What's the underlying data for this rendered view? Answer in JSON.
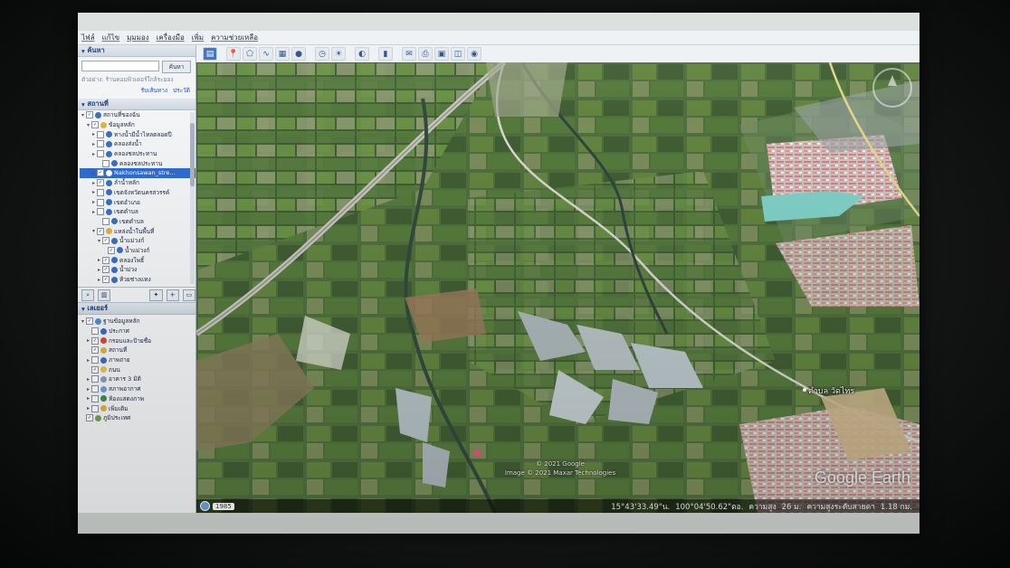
{
  "menu": [
    "ไฟล์",
    "แก้ไข",
    "มุมมอง",
    "เครื่องมือ",
    "เพิ่ม",
    "ความช่วยเหลือ"
  ],
  "search": {
    "title": "ค้นหา",
    "placeholder": "",
    "button": "ค้นหา",
    "hint": "ตัวอย่าง: ร้านคอมพิวเตอร์ใกล้ระยอง",
    "link_directions": "รับเส้นทาง",
    "link_history": "ประวัติ"
  },
  "places": {
    "title": "สถานที่",
    "items": [
      {
        "label": "สถานที่ของฉัน",
        "indent": 0,
        "exp": "▾",
        "checked": true,
        "icon": "folder-icon",
        "color": "#3a6fc2"
      },
      {
        "label": "ข้อมูลหลัก",
        "indent": 1,
        "exp": "▾",
        "checked": true,
        "icon": "folder-icon",
        "color": "#e2b23c"
      },
      {
        "label": "ทางน้ำมีน้ำไหลตลอดปี",
        "indent": 2,
        "exp": "▸",
        "checked": false,
        "icon": "path-icon",
        "color": "#3a6fc2"
      },
      {
        "label": "คลองส่งน้ำ",
        "indent": 2,
        "exp": "▸",
        "checked": false,
        "icon": "path-icon",
        "color": "#3a6fc2"
      },
      {
        "label": "คลองชลประทาน",
        "indent": 2,
        "exp": "▸",
        "checked": false,
        "icon": "path-icon",
        "color": "#3a6fc2"
      },
      {
        "label": "คลองชลประทาน",
        "indent": 3,
        "exp": "",
        "checked": false,
        "icon": "path-icon",
        "color": "#3a6fc2"
      },
      {
        "label": "Nakhonsawan_stre...",
        "indent": 2,
        "exp": "▸",
        "checked": true,
        "icon": "path-icon",
        "color": "#ffffff",
        "selected": true
      },
      {
        "label": "ลำน้ำหลัก",
        "indent": 2,
        "exp": "▸",
        "checked": true,
        "icon": "path-icon",
        "color": "#3a6fc2"
      },
      {
        "label": "เขตจังหวัดนครสวรรค์",
        "indent": 2,
        "exp": "▸",
        "checked": false,
        "icon": "path-icon",
        "color": "#3a6fc2"
      },
      {
        "label": "เขตอำเภอ",
        "indent": 2,
        "exp": "▸",
        "checked": false,
        "icon": "path-icon",
        "color": "#3a6fc2"
      },
      {
        "label": "เขตตำบล",
        "indent": 2,
        "exp": "▸",
        "checked": false,
        "icon": "path-icon",
        "color": "#3a6fc2"
      },
      {
        "label": "เขตตำบล",
        "indent": 3,
        "exp": "",
        "checked": false,
        "icon": "path-icon",
        "color": "#3a6fc2"
      },
      {
        "label": "แหล่งน้ำในพื้นที่",
        "indent": 2,
        "exp": "▾",
        "checked": true,
        "icon": "folder-icon",
        "color": "#e2b23c"
      },
      {
        "label": "น้ำแม่วงก์",
        "indent": 3,
        "exp": "▾",
        "checked": true,
        "icon": "path-icon",
        "color": "#3a6fc2"
      },
      {
        "label": "น้ำแม่วงก์",
        "indent": 4,
        "exp": "",
        "checked": true,
        "icon": "path-icon",
        "color": "#3a6fc2"
      },
      {
        "label": "คลองโพธิ์",
        "indent": 3,
        "exp": "▸",
        "checked": true,
        "icon": "path-icon",
        "color": "#3a6fc2"
      },
      {
        "label": "น้ำม่วง",
        "indent": 3,
        "exp": "▸",
        "checked": true,
        "icon": "path-icon",
        "color": "#3a6fc2"
      },
      {
        "label": "ห้วยช่างแทง",
        "indent": 3,
        "exp": "▸",
        "checked": true,
        "icon": "path-icon",
        "color": "#3a6fc2"
      }
    ]
  },
  "layers": {
    "title": "เลเยอร์",
    "items": [
      {
        "label": "ฐานข้อมูลหลัก",
        "indent": 0,
        "exp": "▾",
        "checked": true,
        "icon": "globe-icon",
        "color": "#4a8fd6"
      },
      {
        "label": "ประกาศ",
        "indent": 1,
        "exp": "",
        "checked": false,
        "icon": "info-icon",
        "color": "#3a6fc2"
      },
      {
        "label": "กรอบและป้ายชื่อ",
        "indent": 1,
        "exp": "▸",
        "checked": true,
        "icon": "label-icon",
        "color": "#d9473b"
      },
      {
        "label": "สถานที่",
        "indent": 1,
        "exp": "",
        "checked": true,
        "icon": "place-icon",
        "color": "#e2b23c"
      },
      {
        "label": "ภาพถ่าย",
        "indent": 1,
        "exp": "▸",
        "checked": false,
        "icon": "photo-icon",
        "color": "#3a6fc2"
      },
      {
        "label": "ถนน",
        "indent": 1,
        "exp": "",
        "checked": true,
        "icon": "road-icon",
        "color": "#e8c547"
      },
      {
        "label": "อาคาร 3 มิติ",
        "indent": 1,
        "exp": "▸",
        "checked": false,
        "icon": "building-icon",
        "color": "#8aa0b8"
      },
      {
        "label": "สภาพอากาศ",
        "indent": 1,
        "exp": "▸",
        "checked": false,
        "icon": "weather-icon",
        "color": "#6fa0df"
      },
      {
        "label": "ห้องแสดงภาพ",
        "indent": 1,
        "exp": "▸",
        "checked": false,
        "icon": "gallery-icon",
        "color": "#3a8f4e"
      },
      {
        "label": "เพิ่มเติม",
        "indent": 1,
        "exp": "▸",
        "checked": false,
        "icon": "folder-icon",
        "color": "#e2b23c"
      },
      {
        "label": "ภูมิประเทศ",
        "indent": 0,
        "exp": "",
        "checked": true,
        "icon": "terrain-icon",
        "color": "#6aa84f"
      }
    ]
  },
  "map": {
    "place_label": "ตำบล วัดไทร",
    "copyright_1": "© 2021 Google",
    "copyright_2": "Image © 2021 Maxar Technologies",
    "logo": "Google Earth",
    "year": "1985"
  },
  "status": {
    "lat": "15°43'33.49\"น.",
    "lon": "100°04'50.62\"ตอ.",
    "elev_label": "ความสูง",
    "elev_value": "26 ม.",
    "eye_label": "ความสูงระดับสายตา",
    "eye_value": "1.18 กม."
  }
}
